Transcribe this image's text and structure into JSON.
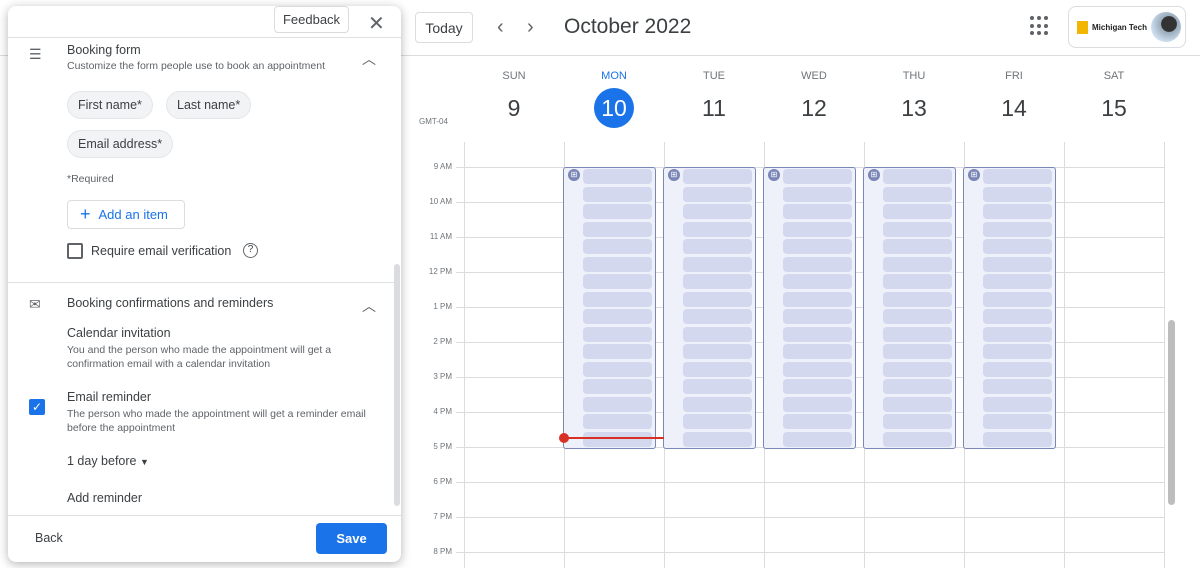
{
  "header": {
    "today": "Today",
    "prev_icon": "‹",
    "next_icon": "›",
    "month": "October 2022",
    "account_org": "Michigan Tech",
    "timezone": "GMT-04"
  },
  "days": [
    {
      "dow": "SUN",
      "num": "9"
    },
    {
      "dow": "MON",
      "num": "10",
      "selected": true
    },
    {
      "dow": "TUE",
      "num": "11"
    },
    {
      "dow": "WED",
      "num": "12"
    },
    {
      "dow": "THU",
      "num": "13"
    },
    {
      "dow": "FRI",
      "num": "14"
    },
    {
      "dow": "SAT",
      "num": "15"
    }
  ],
  "hours": [
    "9 AM",
    "10 AM",
    "11 AM",
    "12 PM",
    "1 PM",
    "2 PM",
    "3 PM",
    "4 PM",
    "5 PM",
    "6 PM",
    "7 PM",
    "8 PM"
  ],
  "availability": {
    "days": [
      "MON",
      "TUE",
      "WED",
      "THU",
      "FRI"
    ],
    "start": "9 AM",
    "end": "5 PM",
    "slots_per_day": 16,
    "current_time_day": "MON"
  },
  "panel": {
    "feedback": "Feedback",
    "booking_form": {
      "title": "Booking form",
      "subtitle": "Customize the form people use to book an appointment",
      "fields": [
        "First name*",
        "Last name*",
        "Email address*"
      ],
      "required_note": "*Required",
      "add_item": "Add an item",
      "verify_label": "Require email verification",
      "verify_checked": false
    },
    "confirmations": {
      "title": "Booking confirmations and reminders",
      "invitation_title": "Calendar invitation",
      "invitation_desc": "You and the person who made the appointment will get a confirmation email with a calendar invitation",
      "reminder_title": "Email reminder",
      "reminder_desc": "The person who made the appointment will get a reminder email before the appointment",
      "reminder_checked": true,
      "reminder_time": "1 day before",
      "add_reminder": "Add reminder"
    },
    "back": "Back",
    "save": "Save"
  },
  "colors": {
    "accent": "#1a73e8",
    "slot": "#d3d8ef",
    "slot_border": "#7986b6",
    "now": "#d93025"
  }
}
